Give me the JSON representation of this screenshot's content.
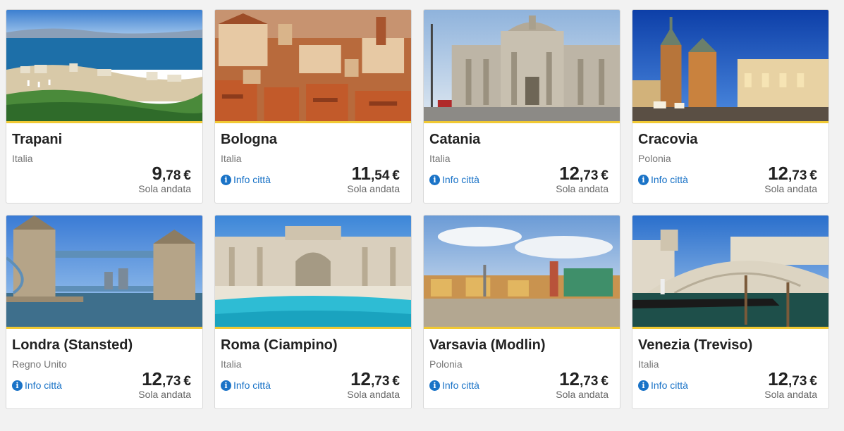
{
  "colors": {
    "accent_line": "#f1c933",
    "link": "#1a73c7"
  },
  "cards": [
    {
      "city": "Trapani",
      "country": "Italia",
      "info": "",
      "price_int": "9",
      "price_dec": ",78",
      "currency": "€",
      "note": "Sola andata",
      "image": "coastal-town-photo"
    },
    {
      "city": "Bologna",
      "country": "Italia",
      "info": "Info città",
      "price_int": "11",
      "price_dec": ",54",
      "currency": "€",
      "note": "Sola andata",
      "image": "rooftops-photo"
    },
    {
      "city": "Catania",
      "country": "Italia",
      "info": "Info città",
      "price_int": "12",
      "price_dec": ",73",
      "currency": "€",
      "note": "Sola andata",
      "image": "cathedral-photo"
    },
    {
      "city": "Cracovia",
      "country": "Polonia",
      "info": "Info città",
      "price_int": "12",
      "price_dec": ",73",
      "currency": "€",
      "note": "Sola andata",
      "image": "night-square-photo"
    },
    {
      "city": "Londra (Stansted)",
      "country": "Regno Unito",
      "info": "Info città",
      "price_int": "12",
      "price_dec": ",73",
      "currency": "€",
      "note": "Sola andata",
      "image": "tower-bridge-photo"
    },
    {
      "city": "Roma (Ciampino)",
      "country": "Italia",
      "info": "Info città",
      "price_int": "12",
      "price_dec": ",73",
      "currency": "€",
      "note": "Sola andata",
      "image": "fountain-photo"
    },
    {
      "city": "Varsavia (Modlin)",
      "country": "Polonia",
      "info": "Info città",
      "price_int": "12",
      "price_dec": ",73",
      "currency": "€",
      "note": "Sola andata",
      "image": "old-town-photo"
    },
    {
      "city": "Venezia (Treviso)",
      "country": "Italia",
      "info": "Info città",
      "price_int": "12",
      "price_dec": ",73",
      "currency": "€",
      "note": "Sola andata",
      "image": "rialto-bridge-photo"
    }
  ]
}
